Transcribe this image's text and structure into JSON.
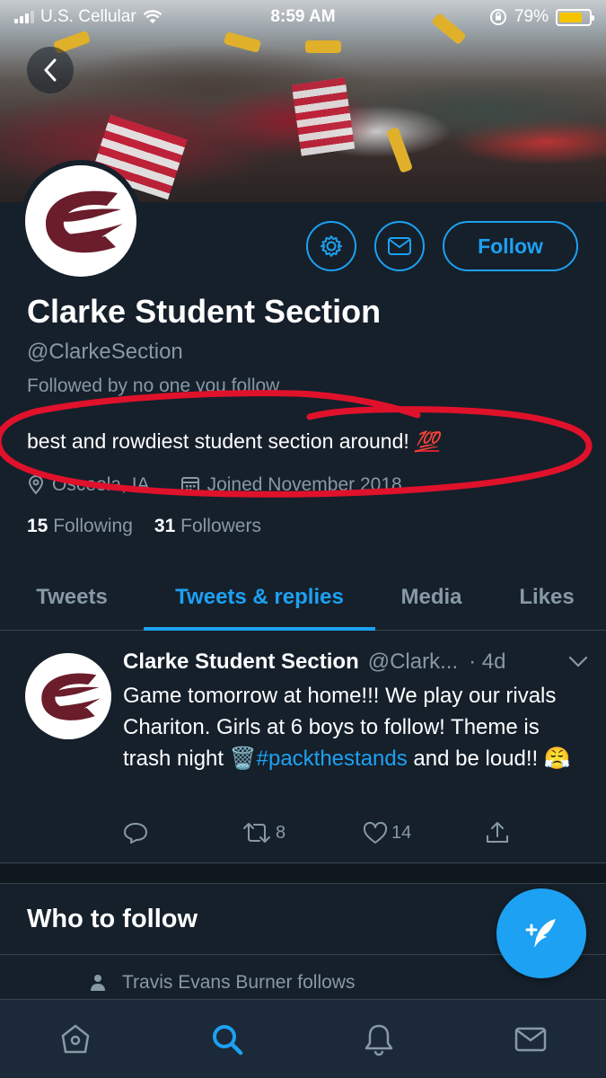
{
  "status_bar": {
    "carrier": "U.S. Cellular",
    "time": "8:59 AM",
    "battery_percent": "79%",
    "battery_level": 0.79
  },
  "profile": {
    "display_name": "Clarke Student Section",
    "handle": "@ClarkeSection",
    "followed_by": "Followed by no one you follow",
    "bio": "best and rowdiest student section around!",
    "bio_emoji": "💯",
    "location": "Osceola, IA",
    "joined": "Joined November 2018",
    "following_count": "15",
    "following_label": "Following",
    "followers_count": "31",
    "followers_label": "Followers",
    "follow_button": "Follow"
  },
  "tabs": [
    {
      "label": "Tweets",
      "active": false
    },
    {
      "label": "Tweets & replies",
      "active": true
    },
    {
      "label": "Media",
      "active": false
    },
    {
      "label": "Likes",
      "active": false
    }
  ],
  "tweet": {
    "name": "Clarke Student Section",
    "handle": "@Clark...",
    "time": "· 4d",
    "text_before_tag": "Game tomorrow at home!!! We play our rivals Chariton. Girls at 6 boys to follow! Theme is trash night 🗑️",
    "hashtag": "#packthestands",
    "text_after_tag": "and be loud!! 😤",
    "retweets": "8",
    "likes": "14"
  },
  "who_to_follow": {
    "title": "Who to follow",
    "suggestion": "Travis Evans Burner follows"
  },
  "colors": {
    "background": "#15202b",
    "accent": "#1da1f2",
    "secondary_text": "#8899a6",
    "annotation": "#e0112b",
    "logo_maroon": "#6b1d2c"
  },
  "icons": [
    "back-icon",
    "gear-icon",
    "mail-icon",
    "location-icon",
    "calendar-icon",
    "reply-icon",
    "retweet-icon",
    "heart-icon",
    "share-icon",
    "chevron-down-icon",
    "person-icon",
    "compose-icon",
    "home-icon",
    "search-icon",
    "bell-icon",
    "inbox-icon"
  ]
}
